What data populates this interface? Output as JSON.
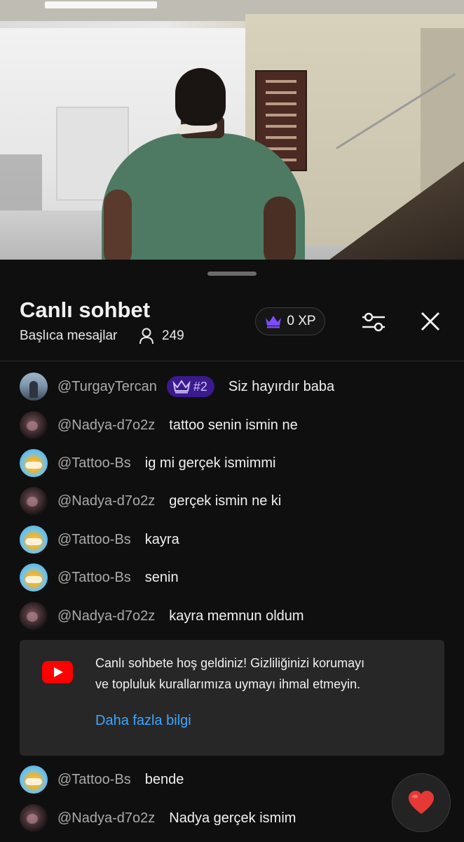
{
  "chat": {
    "title": "Canlı sohbet",
    "mode": "Başlıca mesajlar",
    "viewer_count": "249",
    "xp_label": "0 XP"
  },
  "messages": [
    {
      "author": "@TurgayTercan",
      "badge": "#2",
      "text": "Siz hayırdır baba",
      "avatar": "turgay"
    },
    {
      "author": "@Nadya-d7o2z",
      "text": "tattoo senin ismin ne",
      "avatar": "nadya"
    },
    {
      "author": "@Tattoo-Bs",
      "text": "ig mi gerçek ismimmi",
      "avatar": "tattoo"
    },
    {
      "author": "@Nadya-d7o2z",
      "text": "gerçek ismin ne ki",
      "avatar": "nadya"
    },
    {
      "author": "@Tattoo-Bs",
      "text": "kayra",
      "avatar": "tattoo"
    },
    {
      "author": "@Tattoo-Bs",
      "text": "senin",
      "avatar": "tattoo"
    },
    {
      "author": "@Nadya-d7o2z",
      "text": "kayra memnun oldum",
      "avatar": "nadya"
    },
    {
      "author": "@Tattoo-Bs",
      "text": "bende",
      "avatar": "tattoo"
    },
    {
      "author": "@Nadya-d7o2z",
      "text": "Nadya gerçek ismim",
      "avatar": "nadya"
    }
  ],
  "welcome": {
    "line1": "Canlı sohbete hoş geldiniz! Gizliliğinizi korumayı",
    "line2": "ve topluluk kurallarımıza uymayı ihmal etmeyin.",
    "link": "Daha fazla bilgi"
  },
  "icons": {
    "viewers": "person-icon",
    "xp": "crown-icon",
    "filter": "sliders-icon",
    "close": "close-icon",
    "welcome": "youtube-icon",
    "reaction": "heart-icon"
  },
  "colors": {
    "background": "#0f0f0f",
    "card": "#272727",
    "link": "#3ea6ff",
    "badge": "#3a1a8c",
    "crown": "#7b4dff",
    "youtube_red": "#ff0000",
    "heart": "#e53935"
  }
}
